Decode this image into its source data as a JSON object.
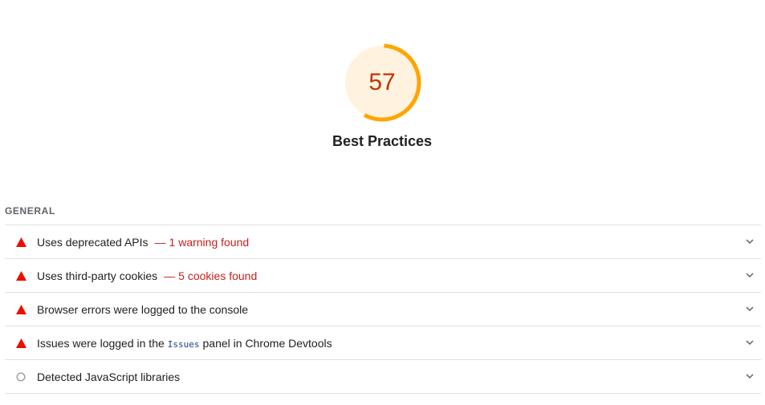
{
  "gauge": {
    "score": "57",
    "score_fraction": 0.57,
    "label": "Best Practices",
    "colors": {
      "arc": "#ffa400",
      "fill": "#fff3e0",
      "text": "#c33300"
    }
  },
  "group": {
    "title": "GENERAL"
  },
  "audits": [
    {
      "icon": "fail-triangle-icon",
      "title": "Uses deprecated APIs",
      "separator": "—",
      "display_value": "1 warning found"
    },
    {
      "icon": "fail-triangle-icon",
      "title": "Uses third-party cookies",
      "separator": "—",
      "display_value": "5 cookies found"
    },
    {
      "icon": "fail-triangle-icon",
      "title": "Browser errors were logged to the console"
    },
    {
      "icon": "fail-triangle-icon",
      "title_before": "Issues were logged in the",
      "title_code": "Issues",
      "title_after": "panel in Chrome Devtools"
    },
    {
      "icon": "informative-circle-icon",
      "title": "Detected JavaScript libraries"
    }
  ],
  "colors": {
    "fail": "#eb0f00",
    "fail_text": "#c5221f",
    "neutral": "#9e9e9e",
    "divider": "#e0e0e0"
  }
}
